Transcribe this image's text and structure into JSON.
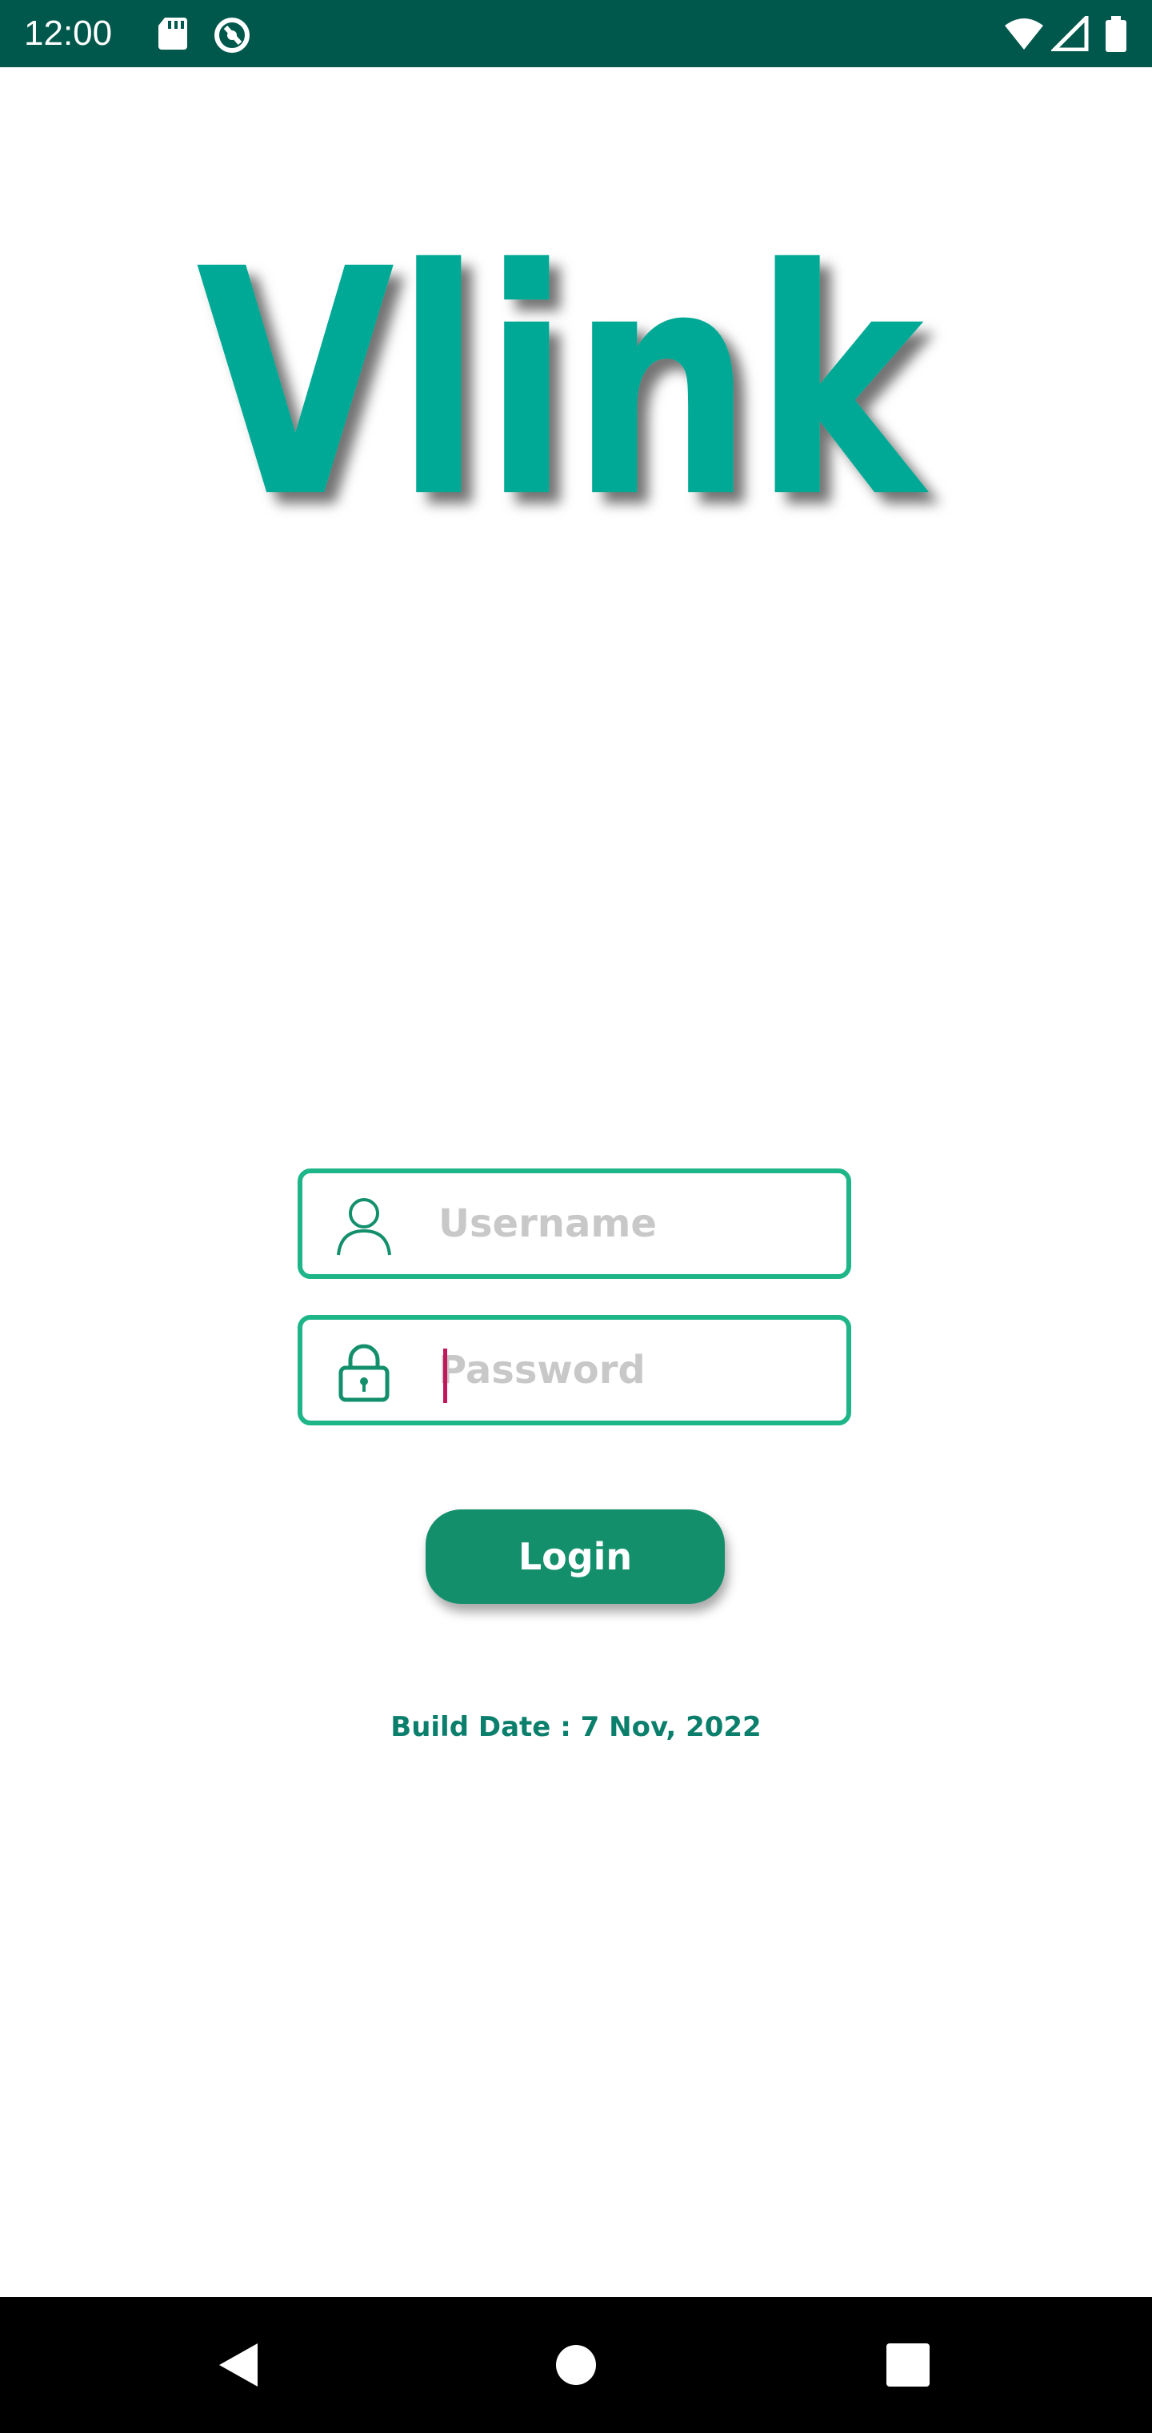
{
  "status_bar": {
    "time": "12:00",
    "icons": [
      "sd-card-icon",
      "sync-icon",
      "wifi-icon",
      "signal-icon",
      "battery-icon"
    ]
  },
  "logo": {
    "text": "Vlink",
    "color": "#05a995"
  },
  "form": {
    "username": {
      "placeholder": "Username",
      "value": ""
    },
    "password": {
      "placeholder": "Password",
      "value": ""
    },
    "login_label": "Login",
    "border_color": "#1eb589",
    "button_color": "#138f6b"
  },
  "build_date": "Build Date : 7 Nov, 2022",
  "nav_bar": {
    "buttons": [
      "back-icon",
      "home-icon",
      "recents-icon"
    ]
  }
}
